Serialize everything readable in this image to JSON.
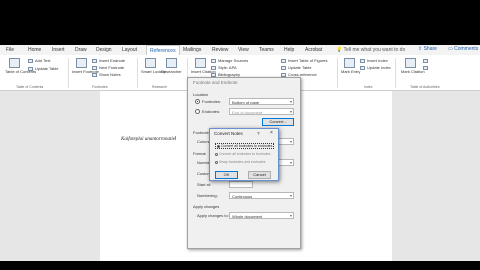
{
  "ribbon_tabs": [
    "File",
    "Home",
    "Insert",
    "Draw",
    "Design",
    "Layout",
    "References",
    "Mailings",
    "Review",
    "View",
    "Teams",
    "Help",
    "Acrobat"
  ],
  "active_tab": "References",
  "tell_me": "Tell me what you want to do",
  "share_label": "Share",
  "comments_label": "Comments",
  "ribbon": {
    "toc_label": "Table of Contents",
    "add_text": "Add Text",
    "update_table": "Update Table",
    "toc_group": "Table of Contents",
    "insert_footnote": "Insert Footnote",
    "insert_endnote": "Insert Endnote",
    "next_footnote": "Next Footnote",
    "show_notes": "Show Notes",
    "footnotes_group": "Footnotes",
    "smart_lookup": "Smart Lookup",
    "researcher": "Researcher",
    "research_group": "Research",
    "insert_citation": "Insert Citation",
    "manage_sources": "Manage Sources",
    "style": "Style:",
    "style_value": "APA",
    "bibliography": "Bibliography",
    "insert_table_of_figures": "Insert Table of Figures",
    "update_table2": "Update Table",
    "cross_reference": "Cross-reference",
    "mark_entry": "Mark Entry",
    "insert_index": "Insert Index",
    "update_index": "Update Index",
    "index_group": "Index",
    "mark_citation": "Mark Citation",
    "toa_group": "Table of Authorities"
  },
  "document": {
    "text_a": "Kaifoteplai",
    "text_b": "unantorronatie",
    "cursor_mark": "I"
  },
  "footnote_dialog": {
    "title": "Footnote and Endnote",
    "location_label": "Location",
    "footnotes_label": "Footnotes:",
    "footnotes_value": "Bottom of page",
    "endnotes_label": "Endnotes:",
    "endnotes_value": "End of document",
    "convert_button": "Convert...",
    "footnote_layout_label": "Footnote layout",
    "columns_label": "Columns:",
    "format_label": "Format",
    "number_format_label": "Number format:",
    "custom_mark_label": "Custom mark:",
    "start_at_label": "Start at:",
    "numbering_label": "Numbering:",
    "numbering_value": "Continuous",
    "apply_changes_label": "Apply changes",
    "apply_changes_to_label": "Apply changes to:",
    "apply_changes_to_value": "Whole document"
  },
  "convert_dialog": {
    "title": "Convert Notes",
    "help": "?",
    "close": "×",
    "option1": "Convert all footnotes to endnotes",
    "option2": "Convert all endnotes to footnotes",
    "option3": "Swap footnotes and endnotes",
    "ok": "OK",
    "cancel": "Cancel"
  }
}
